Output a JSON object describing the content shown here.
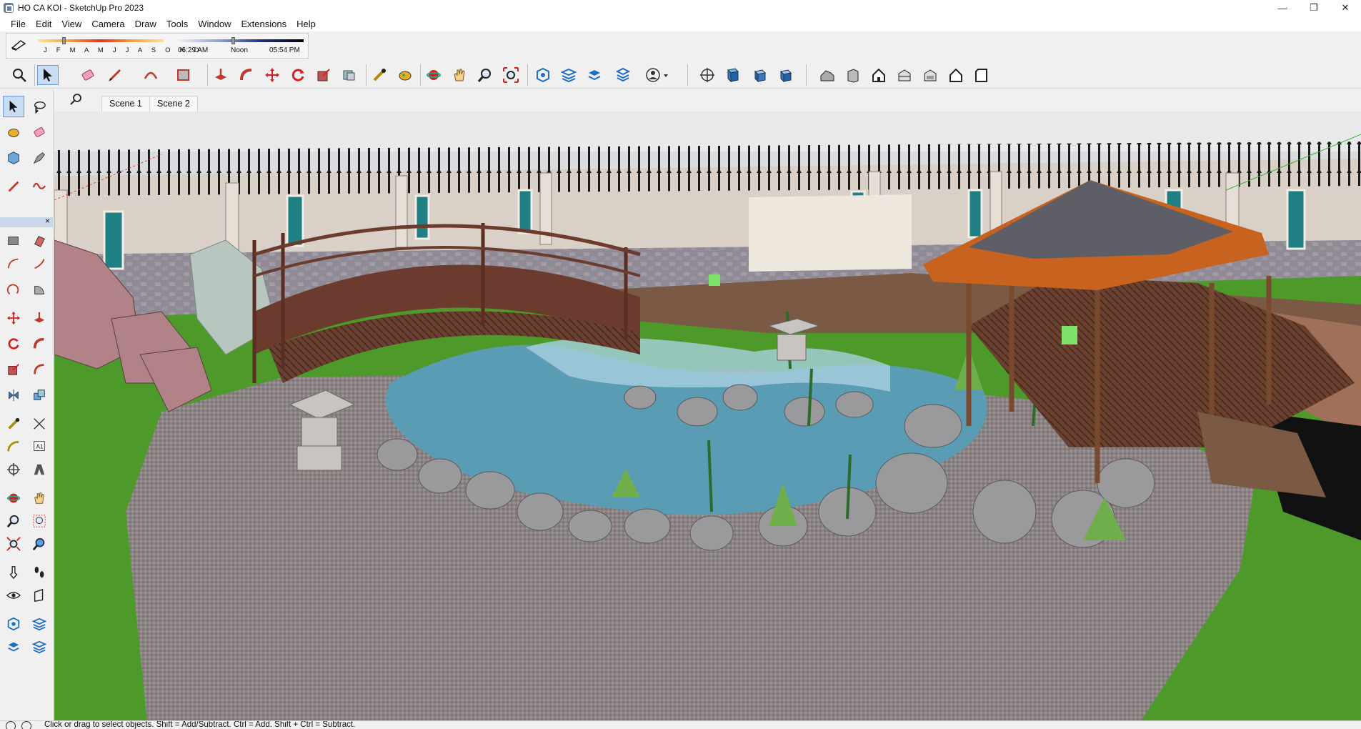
{
  "window": {
    "title": "HO CA KOI  - SketchUp Pro 2023",
    "controls": {
      "minimize": "—",
      "restore": "❐",
      "close": "✕"
    }
  },
  "menu": [
    "File",
    "Edit",
    "View",
    "Camera",
    "Draw",
    "Tools",
    "Window",
    "Extensions",
    "Help"
  ],
  "shadows": {
    "months": "J F M A M J J A S O N D",
    "time_start": "06:29 AM",
    "time_mid": "Noon",
    "time_end": "05:54 PM"
  },
  "scenes": [
    "Scene 1",
    "Scene 2"
  ],
  "status": {
    "text": "Click or drag to select objects. Shift = Add/Subtract. Ctrl = Add. Shift + Ctrl = Subtract."
  },
  "toolbar_icons": [
    "search-icon",
    "select-icon",
    "eraser-icon",
    "pencil-icon",
    "arc-icon",
    "rectangle-icon",
    "push-pull-icon",
    "follow-me-icon",
    "move-icon",
    "rotate-icon",
    "scale-icon",
    "offset-icon",
    "tape-measure-icon",
    "paint-bucket-icon",
    "orbit-icon",
    "pan-icon",
    "zoom-icon",
    "zoom-extents-icon",
    "warehouse-icon",
    "layers-icon",
    "outliner-icon",
    "components-icon",
    "account-icon",
    "iso-view-icon",
    "top-view-icon",
    "front-view-icon",
    "right-view-icon",
    "house-iso-icon",
    "house-side-icon",
    "house-front-icon",
    "house-back-icon",
    "house-top-icon",
    "house-left-icon"
  ],
  "colors": {
    "accent": "#c9dcf5",
    "accent_border": "#6b9ad8",
    "grass": "#4d9a2a",
    "water": "#5a9cb3"
  }
}
